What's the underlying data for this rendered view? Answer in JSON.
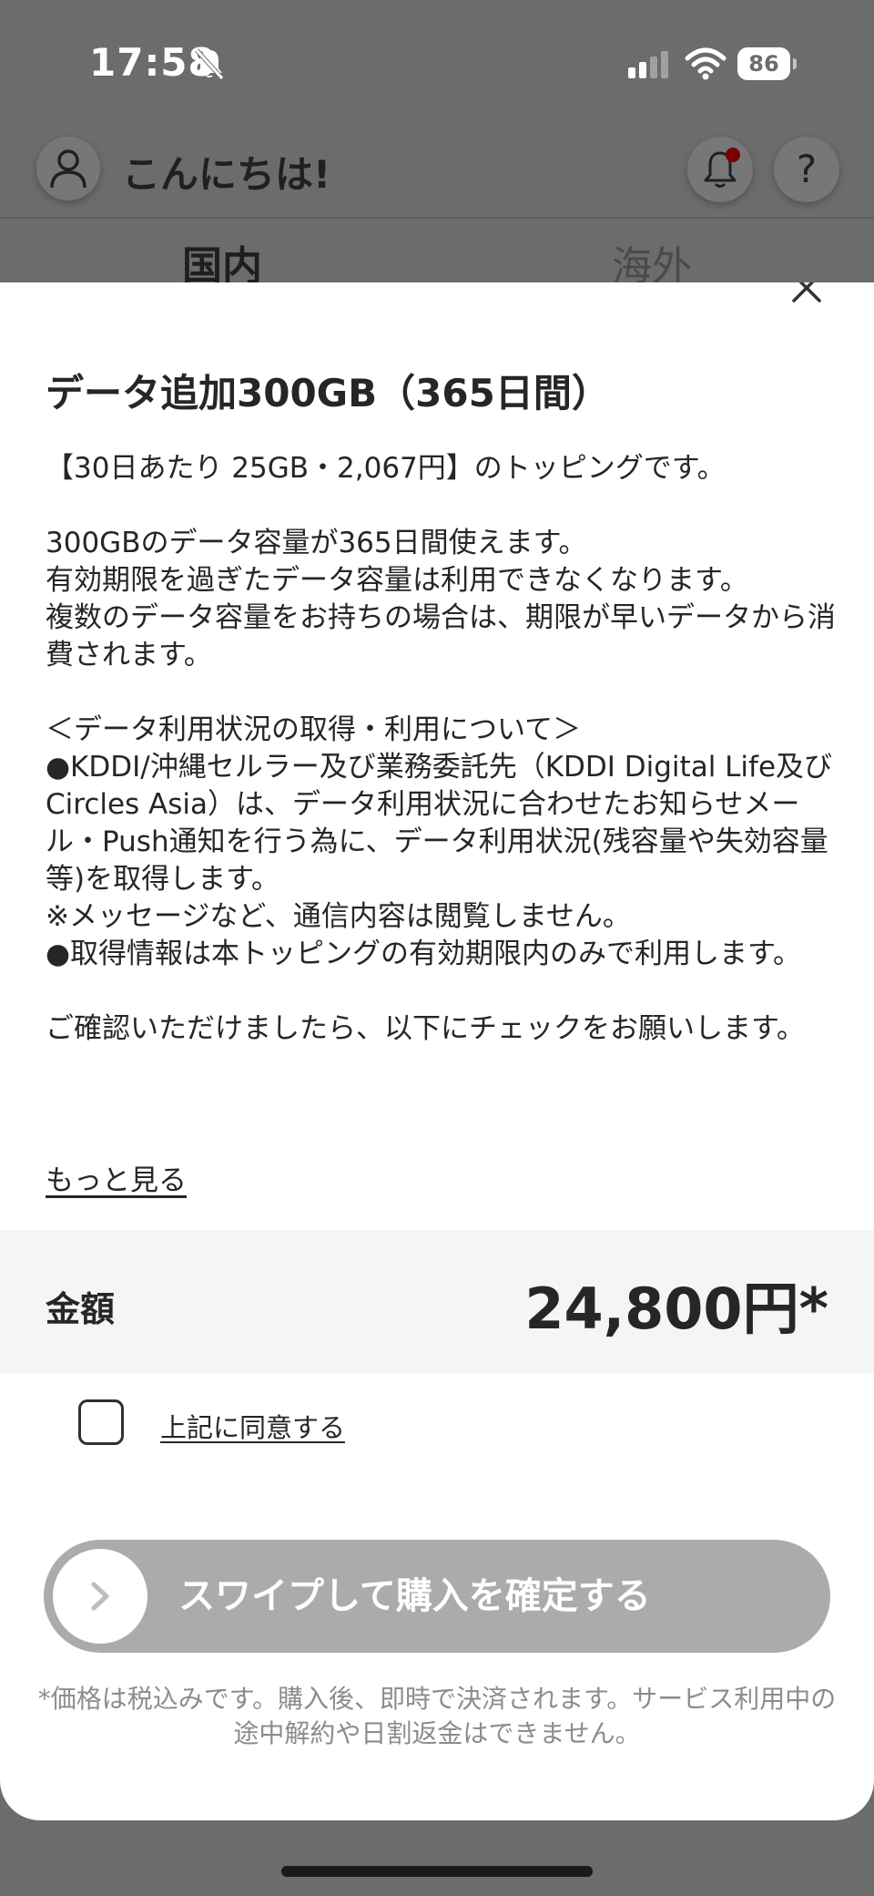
{
  "status_bar": {
    "time": "17:58",
    "battery": "86",
    "icons": [
      "bell-off-icon",
      "signal-icon",
      "wifi-icon",
      "battery-icon"
    ]
  },
  "header": {
    "greeting": "こんにちは!",
    "help_symbol": "?",
    "icons": [
      "user-icon",
      "bell-icon"
    ]
  },
  "tabs": [
    {
      "label": "国内",
      "selected": true
    },
    {
      "label": "海外",
      "selected": false
    }
  ],
  "sheet": {
    "title": "データ追加300GB（365日間）",
    "description": "【30日あたり 25GB・2,067円】のトッピングです。\n\n300GBのデータ容量が365日間使えます。\n有効期限を過ぎたデータ容量は利用できなくなります。\n複数のデータ容量をお持ちの場合は、期限が早いデータから消費されます。\n\n＜データ利用状況の取得・利用について＞\n●KDDI/沖縄セルラー及び業務委託先（KDDI Digital Life及びCircles Asia）は、データ利用状況に合わせたお知らせメール・Push通知を行う為に、データ利用状況(残容量や失効容量等)を取得します。\n※メッセージなど、通信内容は閲覧しません。\n●取得情報は本トッピングの有効期限内のみで利用します。\n\nご確認いただけましたら、以下にチェックをお願いします。",
    "more_label": "もっと見る",
    "price_label": "金額",
    "price_value": "24,800円*",
    "agree_label": "上記に同意する",
    "agree_checked": false,
    "swipe_label": "スワイプして購入を確定する",
    "disclaimer": "*価格は税込みです。購入後、即時で決済されます。サービス利用中の途中解約や日割返金はできません。"
  },
  "colors": {
    "overlay": "#6c6c6c",
    "sheet": "#ffffff",
    "price_row": "#f5f5f5",
    "swipe_track_disabled": "#ababab",
    "disclaimer_text": "#8c8c8c",
    "notification_dot": "#7a0000"
  }
}
